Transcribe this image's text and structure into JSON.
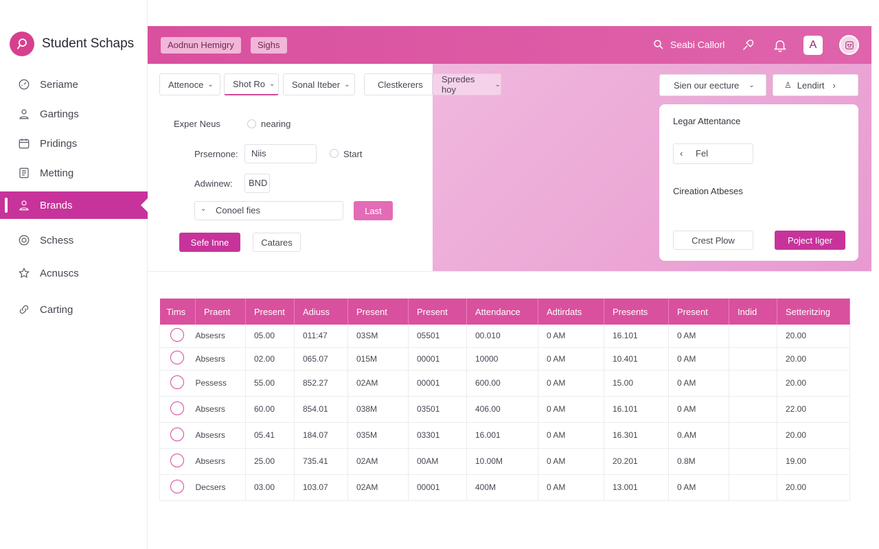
{
  "app": {
    "name": "Student Schaps"
  },
  "sidebar": {
    "items": [
      {
        "label": "Seriame",
        "icon": "gauge-icon",
        "active": false
      },
      {
        "label": "Gartings",
        "icon": "user-icon",
        "active": false
      },
      {
        "label": "Pridings",
        "icon": "calendar-icon",
        "active": false
      },
      {
        "label": "Metting",
        "icon": "document-icon",
        "active": false
      },
      {
        "label": "Brands",
        "icon": "user-group-icon",
        "active": true
      },
      {
        "label": "Schess",
        "icon": "target-icon",
        "active": false
      },
      {
        "label": "Acnuscs",
        "icon": "star-icon",
        "active": false
      },
      {
        "label": "Carting",
        "icon": "link-icon",
        "active": false
      }
    ]
  },
  "header": {
    "chips": [
      "Aodnun Hemigry",
      "Sighs"
    ],
    "search_label": "Seabi Callorl",
    "avatar_letter": "A"
  },
  "filters": [
    {
      "label": "Attenoce",
      "dropdown": true
    },
    {
      "label": "Shot Ro",
      "dropdown": true
    },
    {
      "label": "Sonal Iteber",
      "dropdown": true
    },
    {
      "label": "Clestkerers",
      "dropdown": false
    },
    {
      "label": "Spredes hoy",
      "dropdown": true
    }
  ],
  "right_filters": {
    "select_label": "Sien our eecture",
    "lead_label": "Lendirt"
  },
  "form": {
    "row1_label": "Exper Neus",
    "row1_radio_label": "nearing",
    "row2_label": "Prsernone:",
    "row2_value": "Niis",
    "row2_radio_label": "Start",
    "row3_label": "Adwinew:",
    "row3_value": "BND",
    "select_label": "Conoel fies",
    "last_button": "Last",
    "save_button": "Sefe Inne",
    "cancel_button": "Catares"
  },
  "card": {
    "title": "Legar Attentance",
    "nav_value": "Fel",
    "subtitle": "Cireation Atbeses",
    "outline_button": "Crest Plow",
    "primary_button": "Poject Iiger"
  },
  "table": {
    "headers": [
      "Tims",
      "Praent",
      "Present",
      "Adiuss",
      "Present",
      "Present",
      "Attendance",
      "Adtirdats",
      "Presents",
      "Present",
      "Indid",
      "Setteritzing"
    ],
    "rows": [
      [
        "Absesrs",
        "05.00",
        "011:47",
        "03SM",
        "05501",
        "00.010",
        "0 AM",
        "16.101",
        "0 AM",
        "",
        "20.00"
      ],
      [
        "Absesrs",
        "02.00",
        "065.07",
        "015M",
        "00001",
        "10000",
        "0 AM",
        "10.401",
        "0 AM",
        "",
        "20.00"
      ],
      [
        "Pessess",
        "55.00",
        "852.27",
        "02AM",
        "00001",
        "600.00",
        "0 AM",
        "15.00",
        "0 AM",
        "",
        "20.00"
      ],
      [
        "Absesrs",
        "60.00",
        "854.01",
        "038M",
        "03501",
        "406.00",
        "0 AM",
        "16.101",
        "0 AM",
        "",
        "22.00"
      ],
      [
        "Absesrs",
        "05.41",
        "184.07",
        "035M",
        "03301",
        "16.001",
        "0 AM",
        "16.301",
        "0.AM",
        "",
        "20.00"
      ],
      [
        "Absesrs",
        "25.00",
        "735.41",
        "02AM",
        "00AM",
        "10.00M",
        "0 AM",
        "20.201",
        "0.8M",
        "",
        "19.00"
      ],
      [
        "Decsers",
        "03.00",
        "103.07",
        "02AM",
        "00001",
        "400M",
        "0 AM",
        "13.001",
        "0 AM",
        "",
        "20.00"
      ]
    ]
  },
  "colors": {
    "accent": "#c7339a",
    "header": "#d9509e",
    "panel": "#f0b8de"
  }
}
